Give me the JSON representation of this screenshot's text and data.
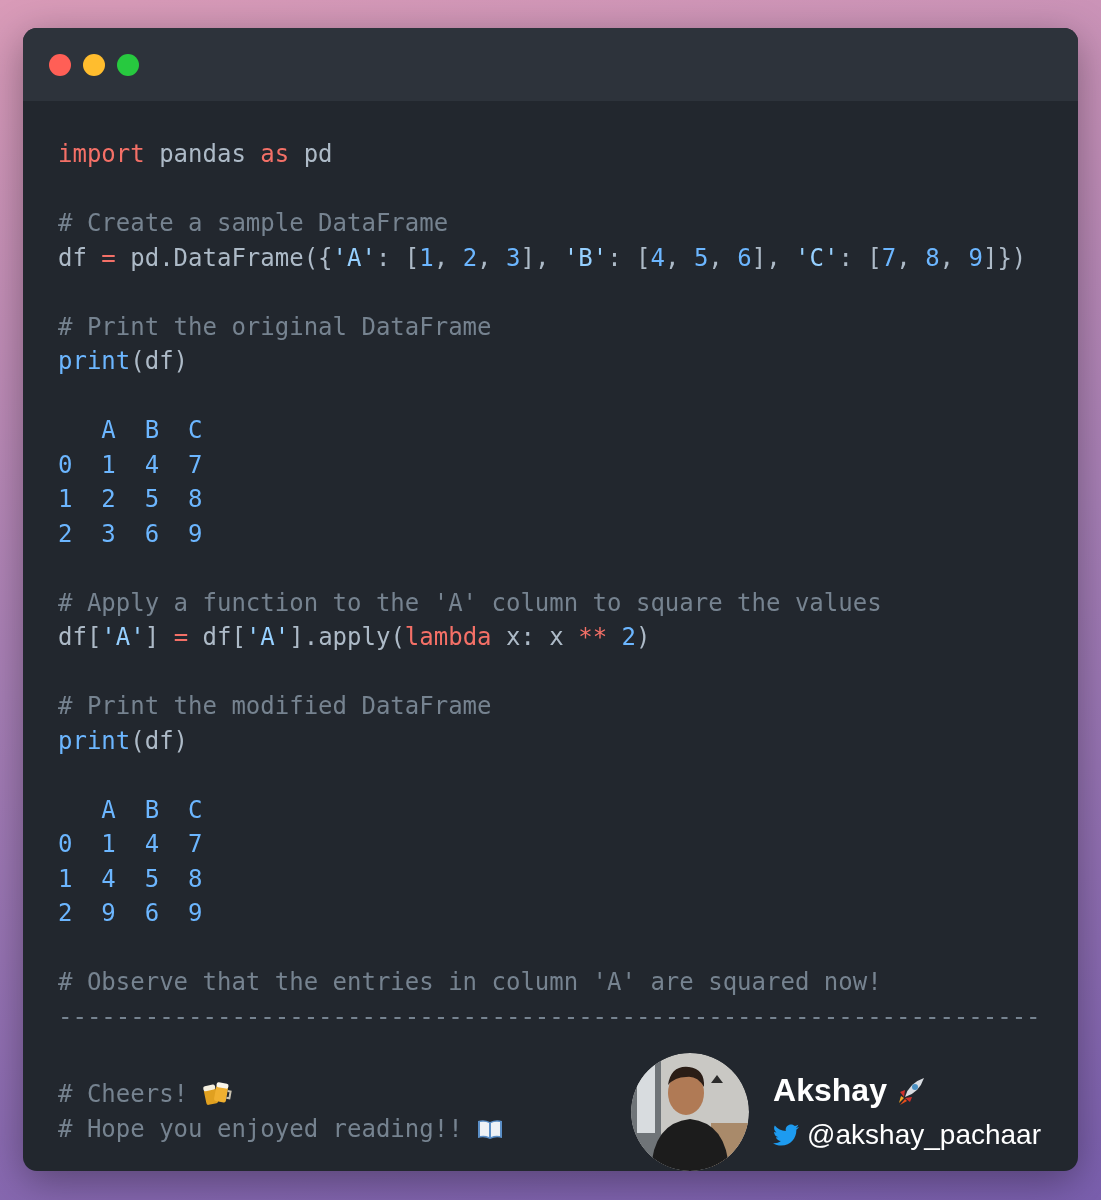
{
  "window": {
    "controls": [
      {
        "color": "#ff5f56"
      },
      {
        "color": "#ffbd2e"
      },
      {
        "color": "#27c93f"
      }
    ]
  },
  "code": {
    "blocks": [
      {
        "lines": [
          {
            "tokens": [
              {
                "kind": "kw",
                "text": "import"
              },
              {
                "kind": "plain",
                "text": " pandas "
              },
              {
                "kind": "kw",
                "text": "as"
              },
              {
                "kind": "plain",
                "text": " pd"
              }
            ]
          }
        ]
      },
      {
        "lines": [
          {
            "tokens": [
              {
                "kind": "comment",
                "text": "# Create a sample DataFrame"
              }
            ]
          },
          {
            "tokens": [
              {
                "kind": "plain",
                "text": "df "
              },
              {
                "kind": "op",
                "text": "="
              },
              {
                "kind": "plain",
                "text": " pd.DataFrame({"
              },
              {
                "kind": "str",
                "text": "'A'"
              },
              {
                "kind": "plain",
                "text": ": ["
              },
              {
                "kind": "num",
                "text": "1"
              },
              {
                "kind": "plain",
                "text": ", "
              },
              {
                "kind": "num",
                "text": "2"
              },
              {
                "kind": "plain",
                "text": ", "
              },
              {
                "kind": "num",
                "text": "3"
              },
              {
                "kind": "plain",
                "text": "], "
              },
              {
                "kind": "str",
                "text": "'B'"
              },
              {
                "kind": "plain",
                "text": ": ["
              },
              {
                "kind": "num",
                "text": "4"
              },
              {
                "kind": "plain",
                "text": ", "
              },
              {
                "kind": "num",
                "text": "5"
              },
              {
                "kind": "plain",
                "text": ", "
              },
              {
                "kind": "num",
                "text": "6"
              },
              {
                "kind": "plain",
                "text": "], "
              },
              {
                "kind": "str",
                "text": "'C'"
              },
              {
                "kind": "plain",
                "text": ": ["
              },
              {
                "kind": "num",
                "text": "7"
              },
              {
                "kind": "plain",
                "text": ", "
              },
              {
                "kind": "num",
                "text": "8"
              },
              {
                "kind": "plain",
                "text": ", "
              },
              {
                "kind": "num",
                "text": "9"
              },
              {
                "kind": "plain",
                "text": "]})"
              }
            ]
          }
        ]
      },
      {
        "lines": [
          {
            "tokens": [
              {
                "kind": "comment",
                "text": "# Print the original DataFrame"
              }
            ]
          },
          {
            "tokens": [
              {
                "kind": "fn",
                "text": "print"
              },
              {
                "kind": "plain",
                "text": "(df)"
              }
            ]
          }
        ]
      },
      {
        "lines": [
          {
            "tokens": [
              {
                "kind": "num",
                "text": "   A  B  C"
              }
            ]
          },
          {
            "tokens": [
              {
                "kind": "num",
                "text": "0  1  4  7"
              }
            ]
          },
          {
            "tokens": [
              {
                "kind": "num",
                "text": "1  2  5  8"
              }
            ]
          },
          {
            "tokens": [
              {
                "kind": "num",
                "text": "2  3  6  9"
              }
            ]
          }
        ]
      },
      {
        "lines": [
          {
            "tokens": [
              {
                "kind": "comment",
                "text": "# Apply a function to the 'A' column to square the values"
              }
            ]
          },
          {
            "tokens": [
              {
                "kind": "plain",
                "text": "df["
              },
              {
                "kind": "str",
                "text": "'A'"
              },
              {
                "kind": "plain",
                "text": "] "
              },
              {
                "kind": "op",
                "text": "="
              },
              {
                "kind": "plain",
                "text": " df["
              },
              {
                "kind": "str",
                "text": "'A'"
              },
              {
                "kind": "plain",
                "text": "].apply("
              },
              {
                "kind": "kw",
                "text": "lambda"
              },
              {
                "kind": "plain",
                "text": " x: x "
              },
              {
                "kind": "op",
                "text": "**"
              },
              {
                "kind": "num",
                "text": " 2"
              },
              {
                "kind": "plain",
                "text": ")"
              }
            ]
          }
        ]
      },
      {
        "lines": [
          {
            "tokens": [
              {
                "kind": "comment",
                "text": "# Print the modified DataFrame"
              }
            ]
          },
          {
            "tokens": [
              {
                "kind": "fn",
                "text": "print"
              },
              {
                "kind": "plain",
                "text": "(df)"
              }
            ]
          }
        ]
      },
      {
        "lines": [
          {
            "tokens": [
              {
                "kind": "num",
                "text": "   A  B  C"
              }
            ]
          },
          {
            "tokens": [
              {
                "kind": "num",
                "text": "0  1  4  7"
              }
            ]
          },
          {
            "tokens": [
              {
                "kind": "num",
                "text": "1  4  5  8"
              }
            ]
          },
          {
            "tokens": [
              {
                "kind": "num",
                "text": "2  9  6  9"
              }
            ]
          }
        ]
      },
      {
        "lines": [
          {
            "tokens": [
              {
                "kind": "comment",
                "text": "# Observe that the entries in column 'A' are squared now!"
              }
            ]
          },
          {
            "tokens": [
              {
                "kind": "comment",
                "text": "--------------------------------------------------------------------"
              }
            ]
          }
        ]
      }
    ]
  },
  "footer": {
    "lines": [
      {
        "tokens": [
          {
            "kind": "comment",
            "text": "# Cheers!"
          }
        ]
      },
      {
        "tokens": [
          {
            "kind": "comment",
            "text": "# Hope you enjoyed reading!!"
          }
        ]
      }
    ],
    "author": {
      "name": "Akshay",
      "handle": "@akshay_pachaar"
    }
  }
}
